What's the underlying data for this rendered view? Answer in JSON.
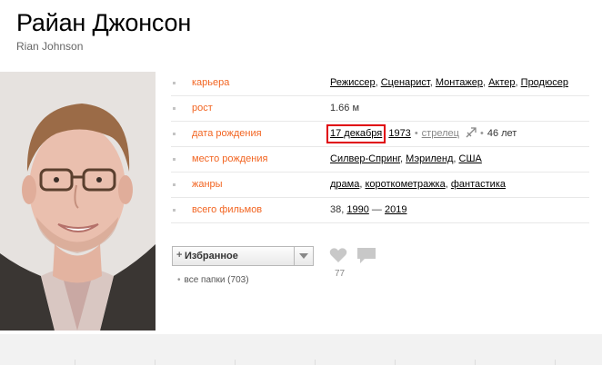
{
  "person": {
    "name_ru": "Райан Джонсон",
    "name_en": "Rian Johnson"
  },
  "info": {
    "career": {
      "label": "карьера",
      "items": [
        "Режиссер",
        "Сценарист",
        "Монтажер",
        "Актер",
        "Продюсер"
      ]
    },
    "height": {
      "label": "рост",
      "value": "1.66 м"
    },
    "birth_date": {
      "label": "дата рождения",
      "day_month": "17 декабря",
      "year": "1973",
      "zodiac": "стрелец",
      "age": "46 лет"
    },
    "birth_place": {
      "label": "место рождения",
      "city": "Силвер-Спринг",
      "state": "Мэриленд",
      "country": "США"
    },
    "genres": {
      "label": "жанры",
      "items": [
        "драма",
        "короткометражка",
        "фантастика"
      ]
    },
    "total_films": {
      "label": "всего фильмов",
      "count": "38",
      "from_year": "1990",
      "dash": "—",
      "to_year": "2019"
    }
  },
  "favorites": {
    "plus": "+",
    "label": "Избранное",
    "folders": "все папки (703)"
  },
  "likes": {
    "count": "77"
  },
  "colors": {
    "label": "#f26522",
    "highlight": "#e0000a"
  }
}
